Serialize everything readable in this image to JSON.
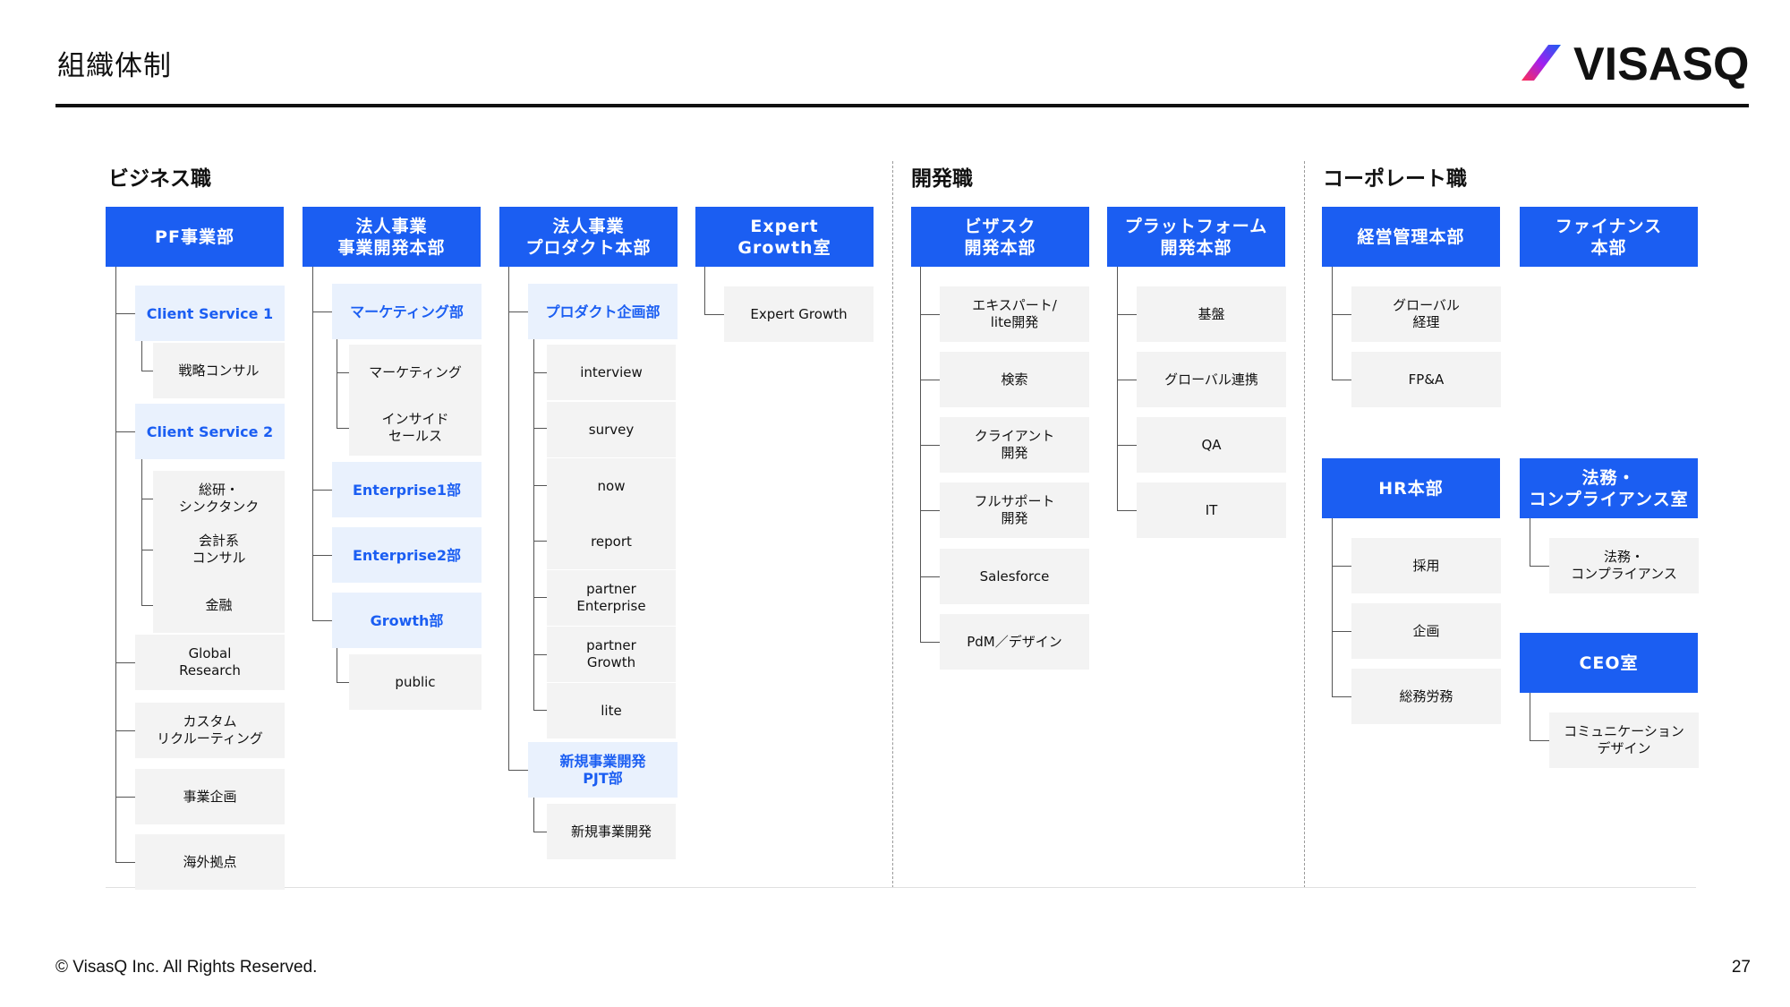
{
  "header": {
    "title": "組織体制",
    "logo_text": "VISASQ"
  },
  "sections": {
    "business": "ビジネス職",
    "dev": "開発職",
    "corporate": "コーポレート職"
  },
  "pf": {
    "head": "PF事業部",
    "cs1": "Client Service 1",
    "senryaku": "戦略コンサル",
    "cs2": "Client Service 2",
    "souken": "総研・\nシンクタンク",
    "kaikei": "会計系\nコンサル",
    "kinyu": "金融",
    "global_research": "Global\nResearch",
    "custom": "カスタム\nリクルーティング",
    "jigyo_kikaku": "事業企画",
    "kaigai": "海外拠点"
  },
  "houjin_dev": {
    "head": "法人事業\n事業開発本部",
    "marketing_dept": "マーケティング部",
    "marketing": "マーケティング",
    "inside_sales": "インサイド\nセールス",
    "ent1": "Enterprise1部",
    "ent2": "Enterprise2部",
    "growth": "Growth部",
    "public": "public"
  },
  "houjin_prod": {
    "head": "法人事業\nプロダクト本部",
    "prod_kikaku": "プロダクト企画部",
    "interview": "interview",
    "survey": "survey",
    "now": "now",
    "report": "report",
    "partner_ent": "partner\nEnterprise",
    "partner_growth": "partner\nGrowth",
    "lite": "lite",
    "shinki_pjt": "新規事業開発\nPJT部",
    "shinki": "新規事業開発"
  },
  "expert": {
    "head": "Expert\nGrowth室",
    "eg": "Expert Growth"
  },
  "visasq_dev": {
    "head": "ビザスク\n開発本部",
    "expert_lite": "エキスパート/\nlite開発",
    "search": "検索",
    "client": "クライアント\n開発",
    "full_support": "フルサポート\n開発",
    "salesforce": "Salesforce",
    "pdm": "PdM／デザイン"
  },
  "platform": {
    "head": "プラットフォーム\n開発本部",
    "kiban": "基盤",
    "global_renkei": "グローバル連携",
    "qa": "QA",
    "it": "IT"
  },
  "keiei": {
    "head": "経営管理本部",
    "global_keiri": "グローバル\n経理",
    "fpa": "FP&A"
  },
  "finance": {
    "head": "ファイナンス\n本部"
  },
  "hr": {
    "head": "HR本部",
    "saiyo": "採用",
    "kikaku": "企画",
    "soumu": "総務労務"
  },
  "legal": {
    "head": "法務・\nコンプライアンス室",
    "legal": "法務・\nコンプライアンス"
  },
  "ceo": {
    "head": "CEO室",
    "comm": "コミュニケーション\nデザイン"
  },
  "footer": {
    "copyright": "© VisasQ Inc. All Rights Reserved.",
    "page": "27"
  },
  "colors": {
    "accent": "#1b5ef2",
    "sub_bg": "#e9f1fd",
    "leaf_bg": "#f3f3f3"
  }
}
